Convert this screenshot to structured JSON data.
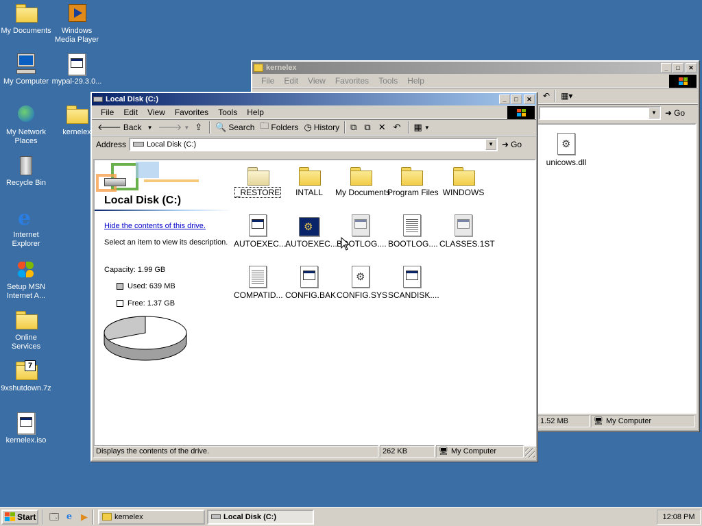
{
  "desktop": {
    "icons": [
      {
        "label": "My Documents",
        "icon": "my-documents-icon"
      },
      {
        "label": "Windows Media Player",
        "icon": "media-player-icon"
      },
      {
        "label": "My Computer",
        "icon": "my-computer-icon"
      },
      {
        "label": "mypal-29.3.0...",
        "icon": "document-icon"
      },
      {
        "label": "My Network Places",
        "icon": "network-icon"
      },
      {
        "label": "kernelex",
        "icon": "folder-icon"
      },
      {
        "label": "Recycle Bin",
        "icon": "recycle-bin-icon"
      },
      {
        "label": "Internet Explorer",
        "icon": "ie-icon"
      },
      {
        "label": "Setup MSN Internet A...",
        "icon": "msn-icon"
      },
      {
        "label": "Online Services",
        "icon": "folder-icon"
      },
      {
        "label": "9xshutdown.7z",
        "icon": "archive-icon"
      },
      {
        "label": "kernelex.iso",
        "icon": "document-icon"
      }
    ]
  },
  "back_window": {
    "title": "kernelex",
    "menu": [
      "File",
      "Edit",
      "View",
      "Favorites",
      "Tools",
      "Help"
    ],
    "go_label": "Go",
    "file": "unicows.dll",
    "status": {
      "size": "1.52 MB",
      "zone": "My Computer"
    }
  },
  "front_window": {
    "title": "Local Disk (C:)",
    "menu": [
      "File",
      "Edit",
      "View",
      "Favorites",
      "Tools",
      "Help"
    ],
    "toolbar": {
      "back": "Back",
      "search": "Search",
      "folders": "Folders",
      "history": "History"
    },
    "address_label": "Address",
    "address_value": "Local Disk (C:)",
    "go_label": "Go",
    "info": {
      "title": "Local Disk (C:)",
      "link": "Hide the contents of this drive.",
      "description": "Select an item to view its description.",
      "capacity": "Capacity: 1.99 GB",
      "used": "Used: 639 MB",
      "free": "Free: 1.37 GB",
      "used_fraction": 0.32
    },
    "files": [
      {
        "name": "_RESTORE",
        "type": "folder"
      },
      {
        "name": "INTALL",
        "type": "folder"
      },
      {
        "name": "My Documents",
        "type": "folder"
      },
      {
        "name": "Program Files",
        "type": "folder"
      },
      {
        "name": "WINDOWS",
        "type": "folder"
      },
      {
        "name": "AUTOEXEC....",
        "type": "doc"
      },
      {
        "name": "AUTOEXEC....",
        "type": "config"
      },
      {
        "name": "BOOTLOG....",
        "type": "grey"
      },
      {
        "name": "BOOTLOG....",
        "type": "text"
      },
      {
        "name": "CLASSES.1ST",
        "type": "grey"
      },
      {
        "name": "COMPATID...",
        "type": "text"
      },
      {
        "name": "CONFIG.BAK",
        "type": "doc"
      },
      {
        "name": "CONFIG.SYS",
        "type": "gear"
      },
      {
        "name": "SCANDISK....",
        "type": "doc"
      }
    ],
    "status": {
      "text": "Displays the contents of the drive.",
      "size": "262 KB",
      "zone": "My Computer"
    }
  },
  "taskbar": {
    "start": "Start",
    "tasks": [
      "kernelex",
      "Local Disk (C:)"
    ],
    "clock": "12:08 PM"
  },
  "colors": {
    "desktop": "#3a6ea5",
    "title_active": "#0a246a",
    "title_inactive": "#808080"
  }
}
